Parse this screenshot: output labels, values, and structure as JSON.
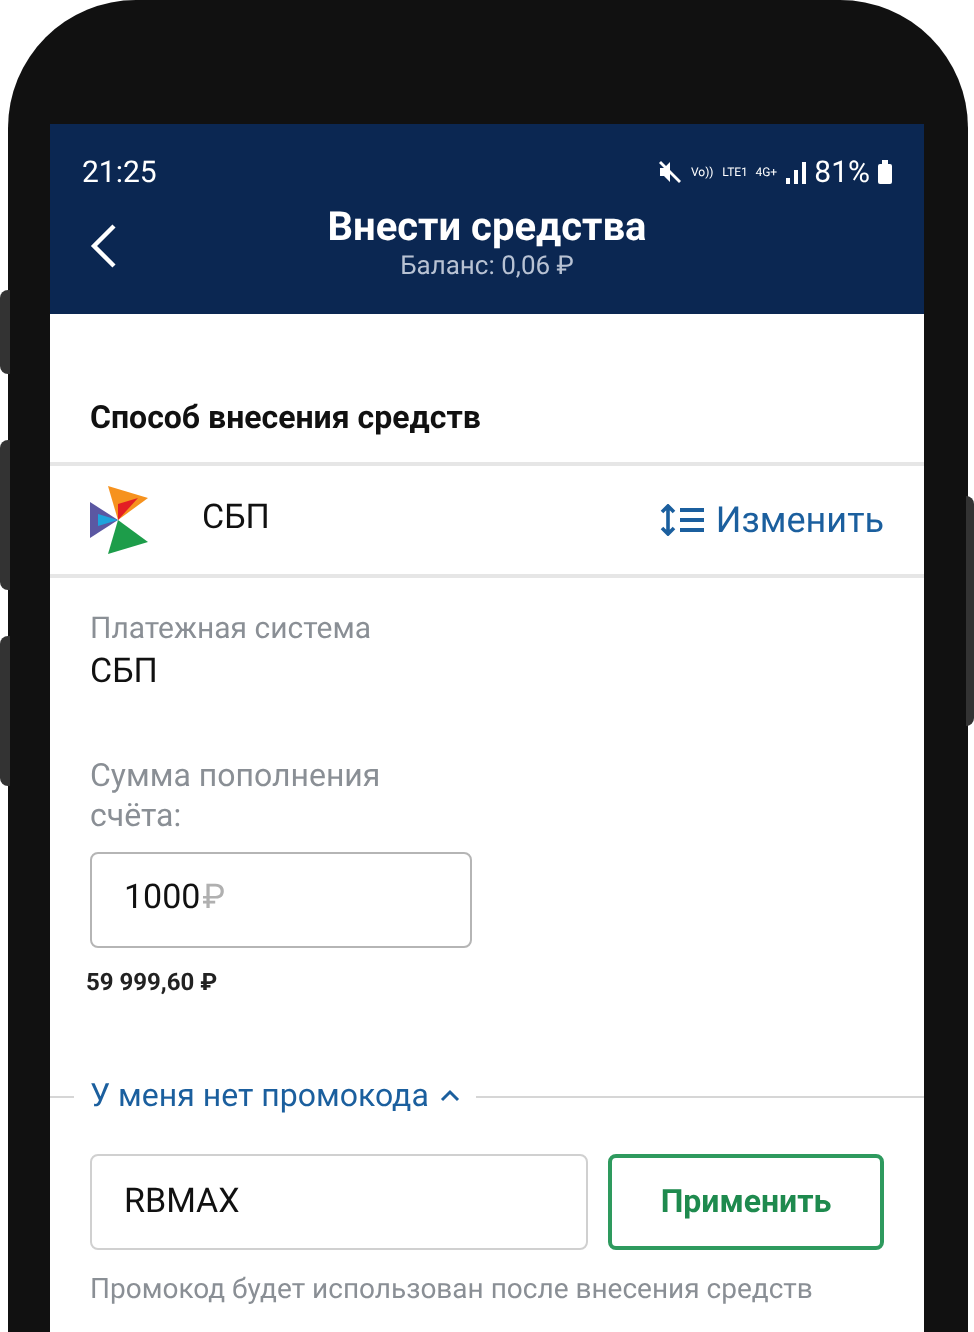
{
  "status_bar": {
    "time": "21:25",
    "network": [
      "Vo))",
      "LTE1",
      "4G+"
    ],
    "battery": "81%"
  },
  "header": {
    "title": "Внести средства",
    "balance": "Баланс: 0,06 ₽"
  },
  "method": {
    "heading": "Способ внесения средств",
    "name": "СБП",
    "change": "Изменить"
  },
  "payment_system": {
    "label": "Платежная система",
    "value": "СБП"
  },
  "amount": {
    "label": "Сумма пополнения счёта:",
    "value": "1000",
    "currency": "₽",
    "limit": "59 999,60 ₽"
  },
  "promo": {
    "toggle": "У меня нет промокода",
    "expanded": true,
    "value": "RBMAX",
    "apply": "Применить",
    "hint": "Промокод будет использован после внесения средств"
  }
}
